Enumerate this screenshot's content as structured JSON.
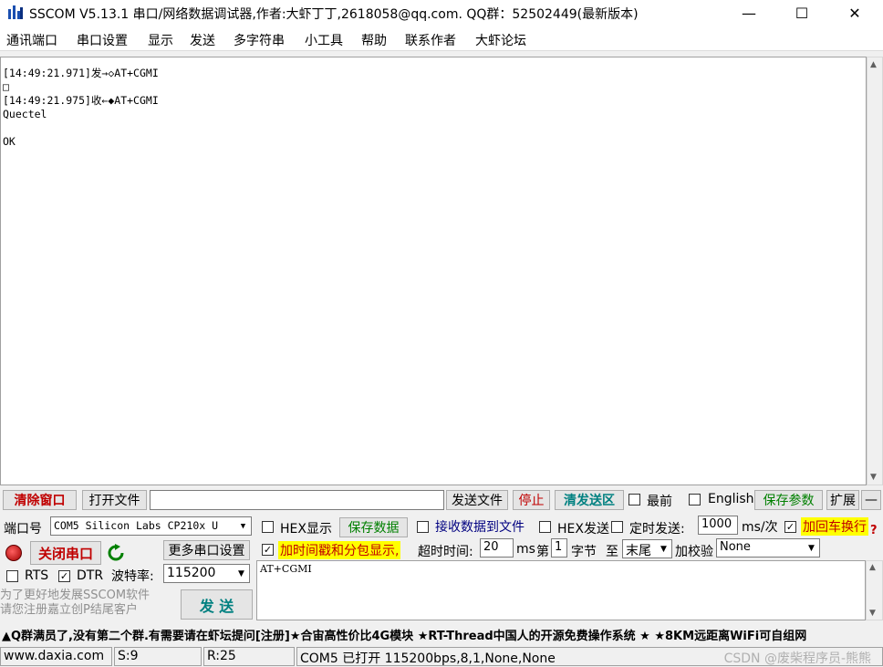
{
  "window": {
    "title": "SSCOM V5.13.1 串口/网络数据调试器,作者:大虾丁丁,2618058@qq.com. QQ群：52502449(最新版本)",
    "minimize": "—",
    "maximize": "☐",
    "close": "✕"
  },
  "menu": [
    "通讯端口",
    "串口设置",
    "显示",
    "发送",
    "多字符串",
    "小工具",
    "帮助",
    "联系作者",
    "大虾论坛"
  ],
  "receive": {
    "lines": [
      "[14:49:21.971]发→◇AT+CGMI",
      "□",
      "[14:49:21.975]收←◆AT+CGMI",
      "Quectel",
      "",
      "OK"
    ]
  },
  "toolbar": {
    "clear": "清除窗口",
    "open_file": "打开文件",
    "file_path": "",
    "send_file": "发送文件",
    "stop": "停止",
    "clear_send": "清发送区",
    "latest": "最前",
    "english": "English",
    "save_params": "保存参数",
    "expand": "扩展",
    "collapse": "—"
  },
  "port": {
    "label": "端口号",
    "value": "COM5 Silicon Labs CP210x U",
    "more": "更多串口设置",
    "close_port": "关闭串口",
    "rts": "RTS",
    "dtr": "DTR",
    "baud_label": "波特率:",
    "baud": "115200"
  },
  "options": {
    "hex_display": "HEX显示",
    "save_data": "保存数据",
    "recv_to_file": "接收数据到文件",
    "hex_send": "HEX发送",
    "timed_send": "定时发送:",
    "interval": "1000",
    "interval_unit": "ms/次",
    "add_crlf": "加回车换行",
    "timestamp": "加时间戳和分包显示,",
    "timeout_label": "超时时间:",
    "timeout": "20",
    "timeout_unit": "ms",
    "nth_label": "第",
    "nth": "1",
    "byte_label": "字节",
    "to_label": "至",
    "end": "末尾",
    "checksum_label": "加校验",
    "checksum": "None"
  },
  "send": {
    "text": "AT+CGMI",
    "button": "发 送"
  },
  "ad": [
    "为了更好地发展SSCOM软件",
    "请您注册嘉立创P结尾客户"
  ],
  "marquee": "▲Q群满员了,没有第二个群.有需要请在虾坛提问[注册]★合宙高性价比4G模块 ★RT-Thread中国人的开源免费操作系统 ★ ★8KM远距离WiFi可自组网",
  "status": {
    "site": "www.daxia.com",
    "s": "S:9",
    "r": "R:25",
    "port": "COM5 已打开  115200bps,8,1,None,None",
    "watermark": "CSDN @废柴程序员-熊熊"
  },
  "colors": {
    "accent_red": "#c00000",
    "accent_green": "#008000",
    "highlight": "#ffff00"
  }
}
